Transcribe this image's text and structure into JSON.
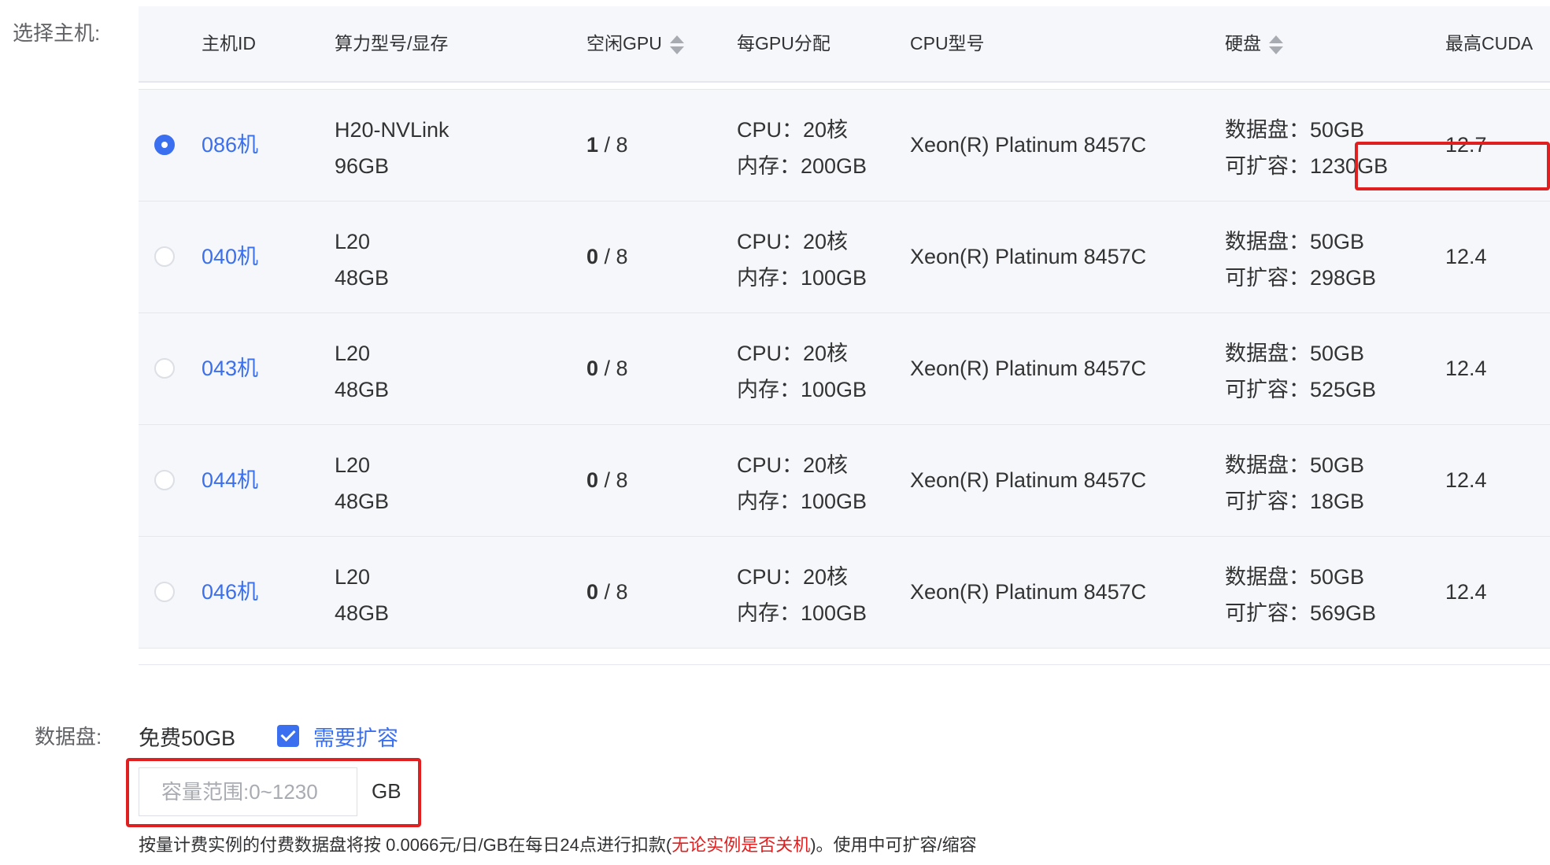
{
  "host_label": "选择主机:",
  "columns": [
    {
      "label": "主机ID",
      "sortable": false
    },
    {
      "label": "算力型号/显存",
      "sortable": false
    },
    {
      "label": "空闲GPU",
      "sortable": true
    },
    {
      "label": "每GPU分配",
      "sortable": false
    },
    {
      "label": "CPU型号",
      "sortable": false
    },
    {
      "label": "硬盘",
      "sortable": true
    },
    {
      "label": "最高CUDA",
      "sortable": false
    }
  ],
  "rows": [
    {
      "selected": true,
      "id": "086机",
      "gpu_model": "H20-NVLink",
      "vram": "96GB",
      "free_gpu": "1",
      "total_gpu": "/ 8",
      "cpu": "CPU：20核",
      "mem": "内存：200GB",
      "cpu_model": "Xeon(R) Platinum 8457C",
      "data_disk": "数据盘：50GB",
      "expandable": "可扩容：1230GB",
      "cuda": "12.7"
    },
    {
      "selected": false,
      "id": "040机",
      "gpu_model": "L20",
      "vram": "48GB",
      "free_gpu": "0",
      "total_gpu": "/ 8",
      "cpu": "CPU：20核",
      "mem": "内存：100GB",
      "cpu_model": "Xeon(R) Platinum 8457C",
      "data_disk": "数据盘：50GB",
      "expandable": "可扩容：298GB",
      "cuda": "12.4"
    },
    {
      "selected": false,
      "id": "043机",
      "gpu_model": "L20",
      "vram": "48GB",
      "free_gpu": "0",
      "total_gpu": "/ 8",
      "cpu": "CPU：20核",
      "mem": "内存：100GB",
      "cpu_model": "Xeon(R) Platinum 8457C",
      "data_disk": "数据盘：50GB",
      "expandable": "可扩容：525GB",
      "cuda": "12.4"
    },
    {
      "selected": false,
      "id": "044机",
      "gpu_model": "L20",
      "vram": "48GB",
      "free_gpu": "0",
      "total_gpu": "/ 8",
      "cpu": "CPU：20核",
      "mem": "内存：100GB",
      "cpu_model": "Xeon(R) Platinum 8457C",
      "data_disk": "数据盘：50GB",
      "expandable": "可扩容：18GB",
      "cuda": "12.4"
    },
    {
      "selected": false,
      "id": "046机",
      "gpu_model": "L20",
      "vram": "48GB",
      "free_gpu": "0",
      "total_gpu": "/ 8",
      "cpu": "CPU：20核",
      "mem": "内存：100GB",
      "cpu_model": "Xeon(R) Platinum 8457C",
      "data_disk": "数据盘：50GB",
      "expandable": "可扩容：569GB",
      "cuda": "12.4"
    }
  ],
  "disk": {
    "label": "数据盘:",
    "free_text": "免费50GB",
    "expand_checked": true,
    "expand_label": "需要扩容",
    "capacity_value": "",
    "capacity_placeholder": "容量范围:0~1230",
    "unit": "GB"
  },
  "footnote": {
    "prefix": "按量计费实例的付费数据盘将按 0.0066元/日/GB在每日24点进行扣款(",
    "warning": "无论实例是否关机",
    "suffix": ")。使用中可扩容/缩容"
  },
  "colors": {
    "accent": "#3a6ff0",
    "highlight": "#e02020",
    "row_bg": "#f5f7fa"
  }
}
